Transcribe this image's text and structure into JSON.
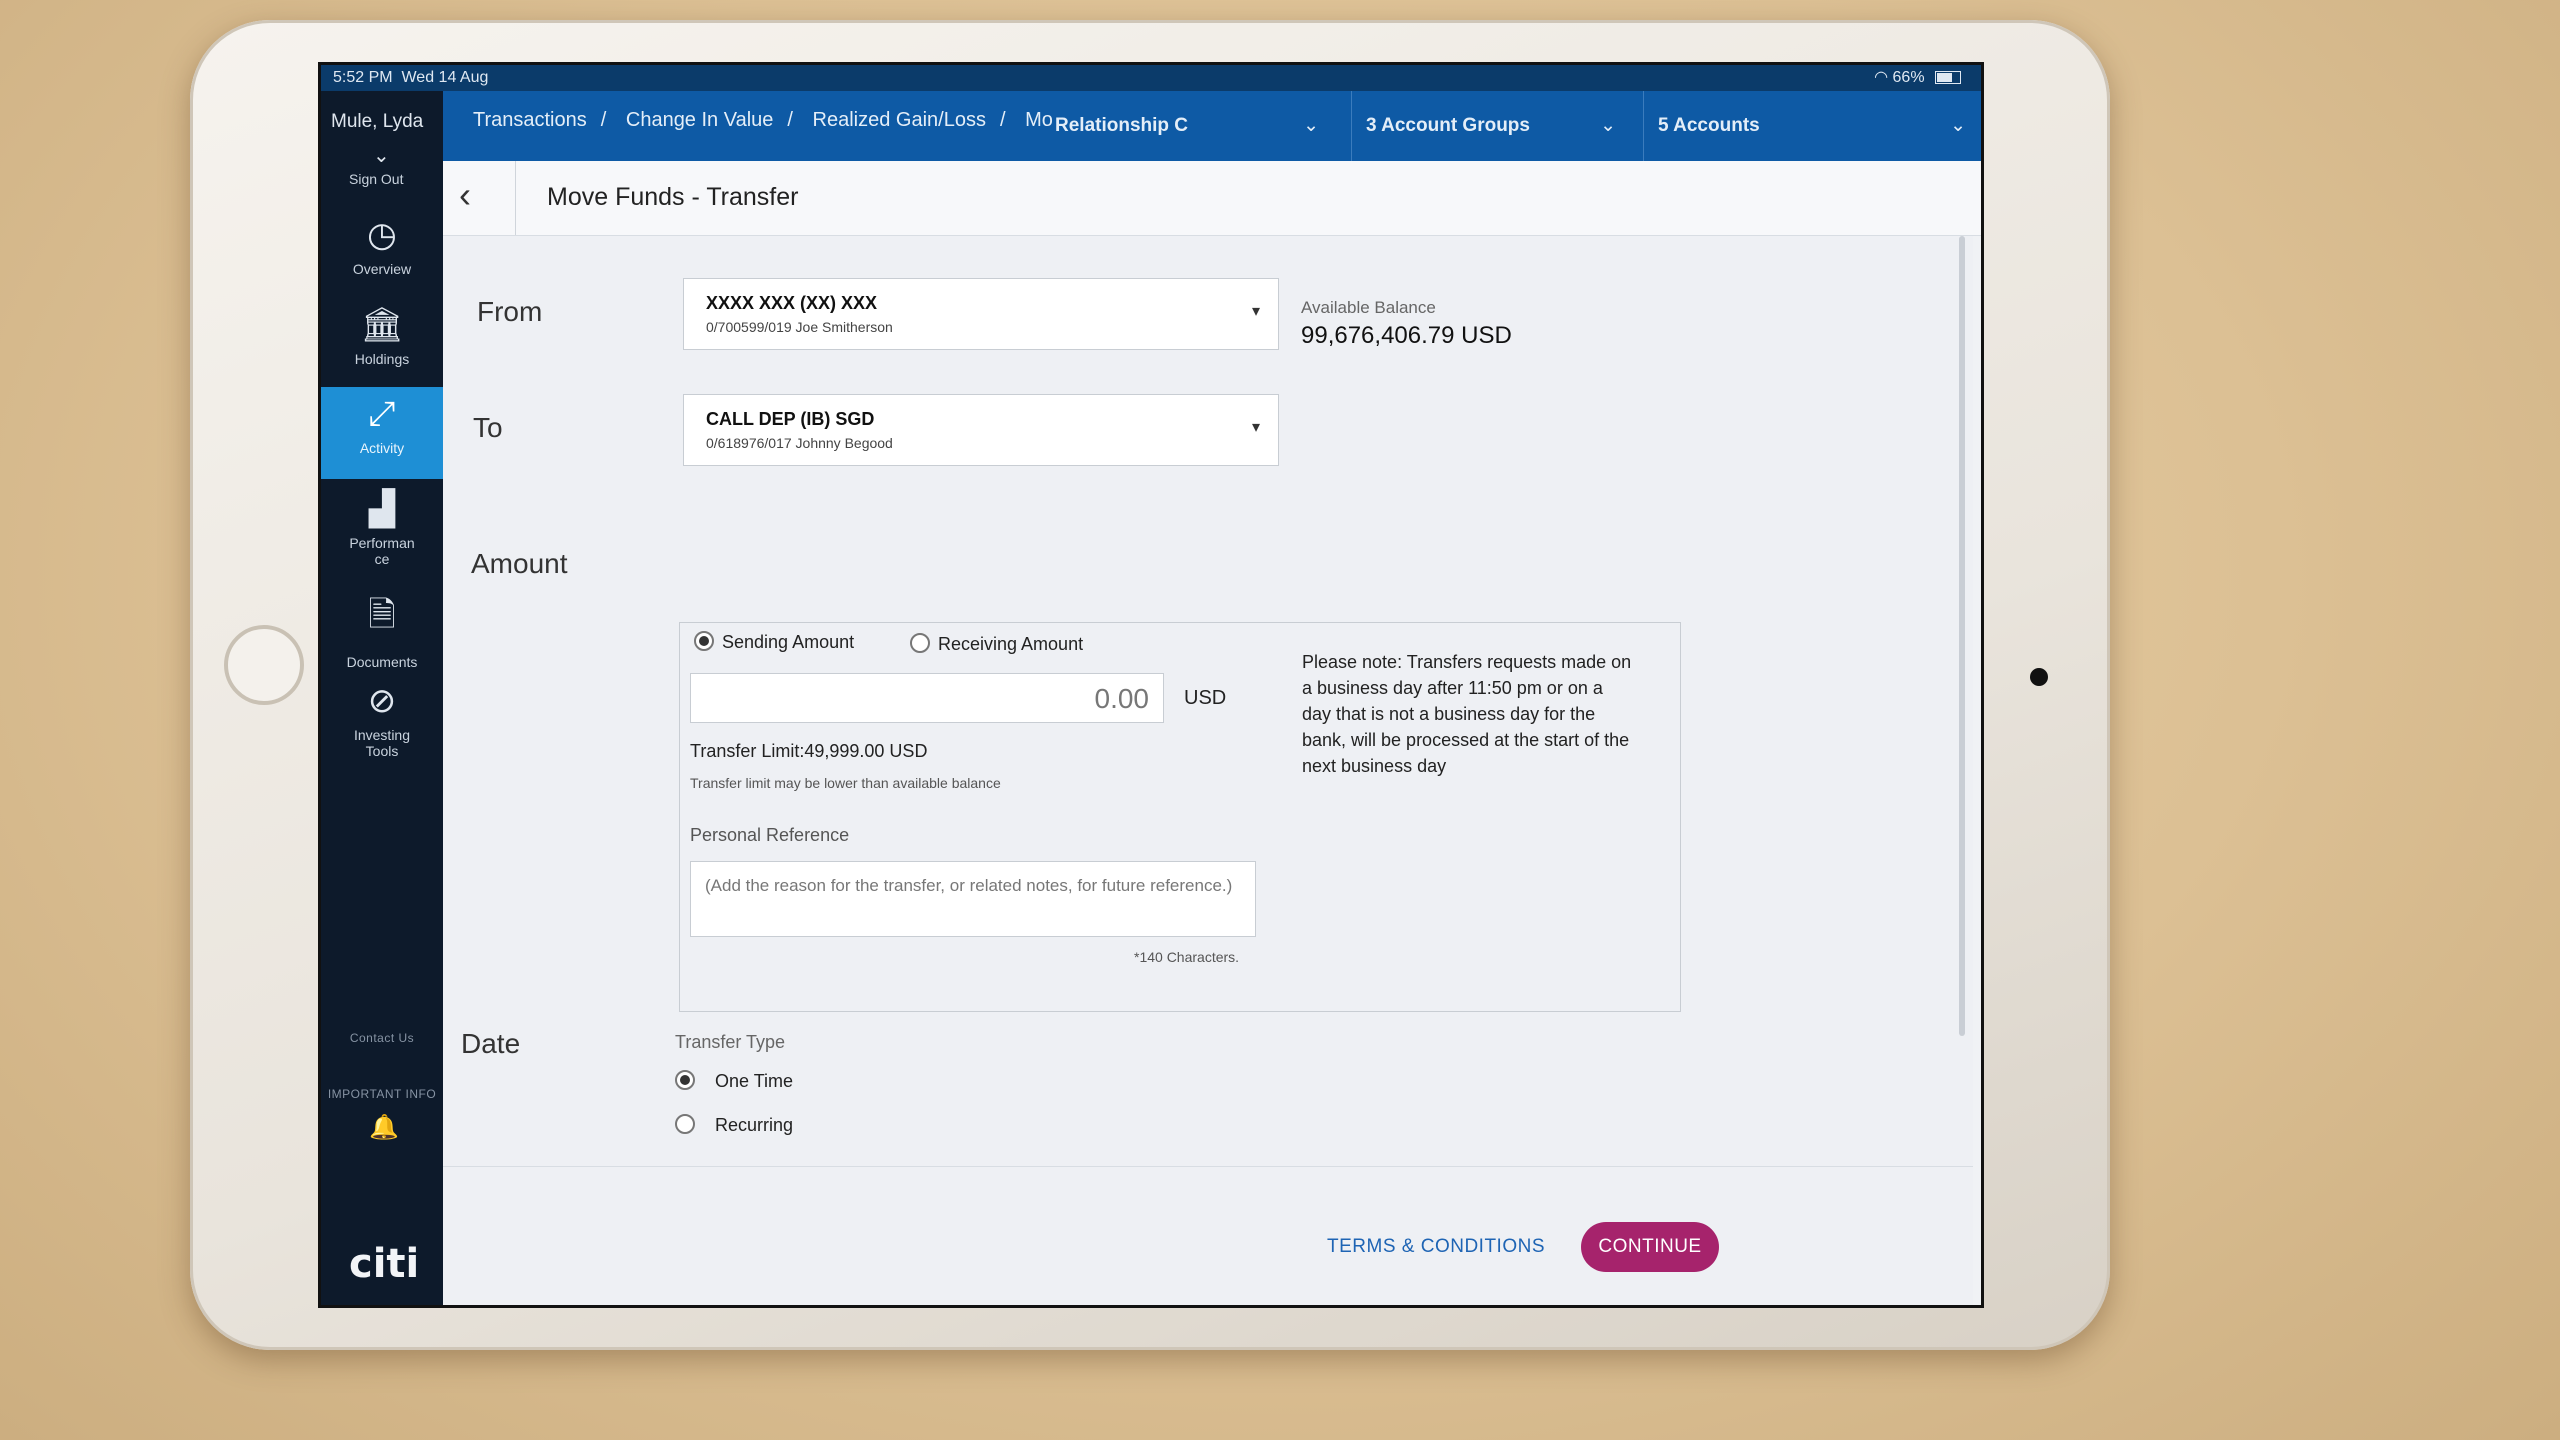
{
  "status": {
    "time": "5:52 PM",
    "date": "Wed 14 Aug",
    "battery": "66%"
  },
  "sidebar": {
    "user": "Mule, Lyda",
    "sign_out": "Sign Out",
    "items": [
      {
        "label": "Overview",
        "icon": "gauge-icon"
      },
      {
        "label": "Holdings",
        "icon": "bank-icon"
      },
      {
        "label": "Activity",
        "icon": "transfer-arrows-icon",
        "active": true
      },
      {
        "label": "Performan ce",
        "icon": "bar-chart-icon"
      },
      {
        "label": "Documents",
        "icon": "document-icon"
      },
      {
        "label": "Investing Tools",
        "icon": "compass-icon"
      }
    ],
    "contact": "Contact Us",
    "important": "IMPORTANT INFO",
    "logo": "citi"
  },
  "topnav": {
    "crumbs": [
      "Transactions",
      "Change In Value",
      "Realized Gain/Loss",
      "Mo"
    ],
    "relationship": "Relationship C",
    "groups": "3 Account Groups",
    "accounts": "5 Accounts"
  },
  "page": {
    "title": "Move Funds - Transfer"
  },
  "from": {
    "label": "From",
    "account": "XXXX XXX (XX) XXX",
    "detail": "0/700599/019 Joe Smitherson"
  },
  "to": {
    "label": "To",
    "account": "CALL DEP (IB) SGD",
    "detail": "0/618976/017 Johnny Begood"
  },
  "balance": {
    "label": "Available Balance",
    "value": "99,676,406.79 USD"
  },
  "amount": {
    "label": "Amount",
    "sending": "Sending Amount",
    "receiving": "Receiving Amount",
    "value": "0.00",
    "currency": "USD",
    "limit": "Transfer Limit:49,999.00 USD",
    "limit_note": "Transfer limit may be lower than available balance",
    "personal_ref_label": "Personal Reference",
    "personal_ref_placeholder": "(Add the reason for the transfer, or related notes, for future reference.)",
    "chars": "*140 Characters.",
    "note": "Please note: Transfers requests made on a business day after 11:50 pm or on a day that is not a business day for the bank, will be processed at the start of the next business day"
  },
  "date": {
    "label": "Date",
    "transfer_type_label": "Transfer Type",
    "one_time": "One Time",
    "recurring": "Recurring"
  },
  "footer": {
    "terms": "TERMS & CONDITIONS",
    "continue": "CONTINUE"
  },
  "colors": {
    "accent": "#1e8fd5",
    "continue": "#a6236c",
    "topbar": "#0e5aa5"
  }
}
